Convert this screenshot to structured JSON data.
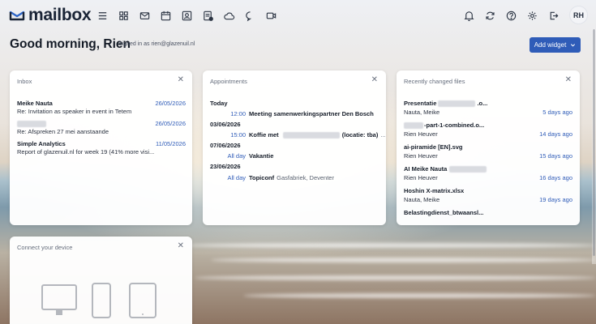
{
  "app": {
    "logo": "mailbox",
    "user_initials": "RH"
  },
  "nav": {
    "left_icons": [
      "menu-icon",
      "apps-grid-icon",
      "mail-icon",
      "calendar-icon",
      "contacts-icon",
      "tasks-icon",
      "drive-cloud-icon",
      "chat-icon",
      "video-icon"
    ],
    "right_icons": [
      "bell-icon",
      "sync-icon",
      "help-icon",
      "gear-icon",
      "logout-icon"
    ]
  },
  "header": {
    "greeting": "Good morning, Rien",
    "signed_in": "Signed in as rien@glazenuil.nl",
    "add_widget": "Add widget"
  },
  "inbox": {
    "title": "Inbox",
    "messages": [
      {
        "from": "Meike Nauta",
        "subject": "Re: Invitation as speaker in event in Tetem",
        "date": "26/05/2026"
      },
      {
        "from": "",
        "subject": "Re: Afspreken 27 mei aanstaande",
        "date": "26/05/2026"
      },
      {
        "from": "Simple Analytics",
        "subject": "Report of glazenuil.nl for week 19 (41% more visi...",
        "date": "11/05/2026"
      }
    ]
  },
  "appointments": {
    "title": "Appointments",
    "today": "Today",
    "items": [
      {
        "time": "12:00",
        "title": "Meeting samenwerkingspartner Den Bosch",
        "location": ""
      },
      {
        "day": "03/06/2026",
        "time": "15:00",
        "title": "Koffie met",
        "title_suffix": "(locatie: tba)",
        "location": "..."
      },
      {
        "day": "07/06/2026",
        "time": "All day",
        "title": "Vakantie",
        "location": ""
      },
      {
        "day": "23/06/2026",
        "time": "All day",
        "title": "Topiconf",
        "location": "Gasfabriek, Deventer"
      }
    ]
  },
  "files": {
    "title": "Recently changed files",
    "items": [
      {
        "name_start": "Presentatie",
        "name_end": ".o...",
        "owner": "Nauta, Meike",
        "ago": "5 days ago"
      },
      {
        "name_start": "",
        "name_end": "-part-1-combined.o...",
        "owner": "Rien Heuver",
        "ago": "14 days ago"
      },
      {
        "name_start": "ai-piramide [EN].svg",
        "name_end": "",
        "owner": "Rien Heuver",
        "ago": "15 days ago"
      },
      {
        "name_start": "AI Meike Nauta",
        "name_end": "",
        "owner": "Rien Heuver",
        "ago": "16 days ago"
      },
      {
        "name_start": "Hoshin X-matrix.xlsx",
        "name_end": "",
        "owner": "Nauta, Meike",
        "ago": "19 days ago"
      },
      {
        "name_start": "Belastingdienst_btwaansl...",
        "name_end": "",
        "owner": "",
        "ago": ""
      }
    ]
  },
  "connect": {
    "title": "Connect your device"
  },
  "colors": {
    "accent": "#2f5cb8",
    "brand_dark": "#1a2436"
  }
}
